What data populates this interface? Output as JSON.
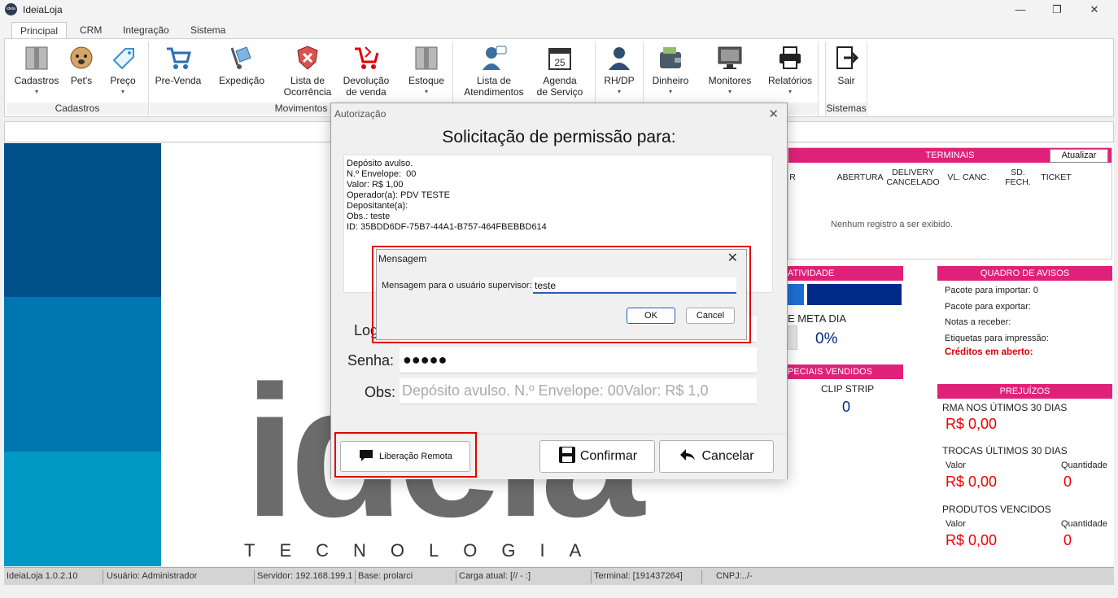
{
  "window": {
    "title": "IdeiaLoja",
    "logo_text": "ideia"
  },
  "window_controls": {
    "minimize": "—",
    "maximize": "❐",
    "close": "✕"
  },
  "tabs": [
    "Principal",
    "CRM",
    "Integração",
    "Sistema"
  ],
  "ribbon": {
    "groups": [
      "Cadastros",
      "Movimentos",
      "Sistemas"
    ],
    "buttons": {
      "cadastros": "Cadastros",
      "pets": "Pet's",
      "preco": "Preço",
      "prevenda": "Pre-Venda",
      "expedicao": "Expedição",
      "ocorrencia_1": "Lista de",
      "ocorrencia_2": "Ocorrência",
      "devolucao_1": "Devolução",
      "devolucao_2": "de venda",
      "estoque": "Estoque",
      "atendimentos_1": "Lista de",
      "atendimentos_2": "Atendimentos",
      "agenda_1": "Agenda",
      "agenda_2": "de Serviço",
      "rhdp": "RH/DP",
      "dinheiro": "Dinheiro",
      "monitores": "Monitores",
      "relatorios": "Relatórios",
      "sair": "Sair"
    }
  },
  "terminals": {
    "header": "TERMINAIS",
    "refresh_button": "Atualizar",
    "columns": [
      "R",
      "ABERTURA",
      "DELIVERY CANCELADO",
      "VL. CANC.",
      "SD. FECH.",
      "TICKET"
    ],
    "empty": "Nenhum registro a ser exibido."
  },
  "atividade": {
    "header": "ATIVIDADE",
    "meta_label": "E META DIA",
    "meta_value": "0%"
  },
  "especiais": {
    "header": "PECIAIS VENDIDOS",
    "item": "CLIP STRIP",
    "value": "0"
  },
  "avisos": {
    "header": "QUADRO DE AVISOS",
    "items": [
      "Pacote para importar: 0",
      "Pacote para exportar:",
      "Notas a receber:",
      "Etiquetas para impressão:"
    ],
    "alert": "Créditos em aberto:"
  },
  "prejuizos": {
    "header": "PREJUÍZOS",
    "rma_label": "RMA NOS ÚTIMOS 30 DIAS",
    "rma_value": "R$ 0,00",
    "trocas_label": "TROCAS ÚLTIMOS 30 DIAS",
    "valor_label": "Valor",
    "quantidade_label": "Quantidade",
    "trocas_value": "R$ 0,00",
    "trocas_qty": "0",
    "vencidos_label": "PRODUTOS VENCIDOS",
    "vencidos_value": "R$ 0,00",
    "vencidos_qty": "0"
  },
  "brand": {
    "big": "ideia",
    "sub": "TECNOLOGIA"
  },
  "status_bar": [
    "IdeiaLoja 1.0.2.10",
    "Usuário: Administrador",
    "Servidor: 192.168.199.1",
    "Base: prolarci",
    "Carga atual: [// - :]",
    "Terminal: [191437264]",
    "CNPJ:../-"
  ],
  "auth_dialog": {
    "title": "Autorização",
    "heading": "Solicitação de permissão para:",
    "info_lines": [
      "Depósito avulso.",
      "N.º Envelope:  00",
      "Valor: R$ 1,00",
      "Operador(a): PDV TESTE",
      "Depositante(a):",
      "Obs.: teste",
      "ID: 35BDD6DF-75B7-44A1-B757-464FBEBBD614"
    ],
    "login_label": "Log",
    "senha_label": "Senha:",
    "senha_value": "●●●●●",
    "obs_label": "Obs:",
    "obs_value": "Depósito avulso. N.º Envelope:  00Valor: R$ 1,0",
    "remote_button": "Liberação Remota",
    "confirm_button": "Confirmar",
    "cancel_button": "Cancelar"
  },
  "message_dialog": {
    "title": "Mensagem",
    "label": "Mensagem para o usuário supervisor:",
    "input_value": "teste",
    "ok_button": "OK",
    "cancel_button": "Cancel"
  },
  "colors": {
    "accent_pink": "#e0217a",
    "alert_red": "#e00000",
    "navy": "#002a8a"
  }
}
